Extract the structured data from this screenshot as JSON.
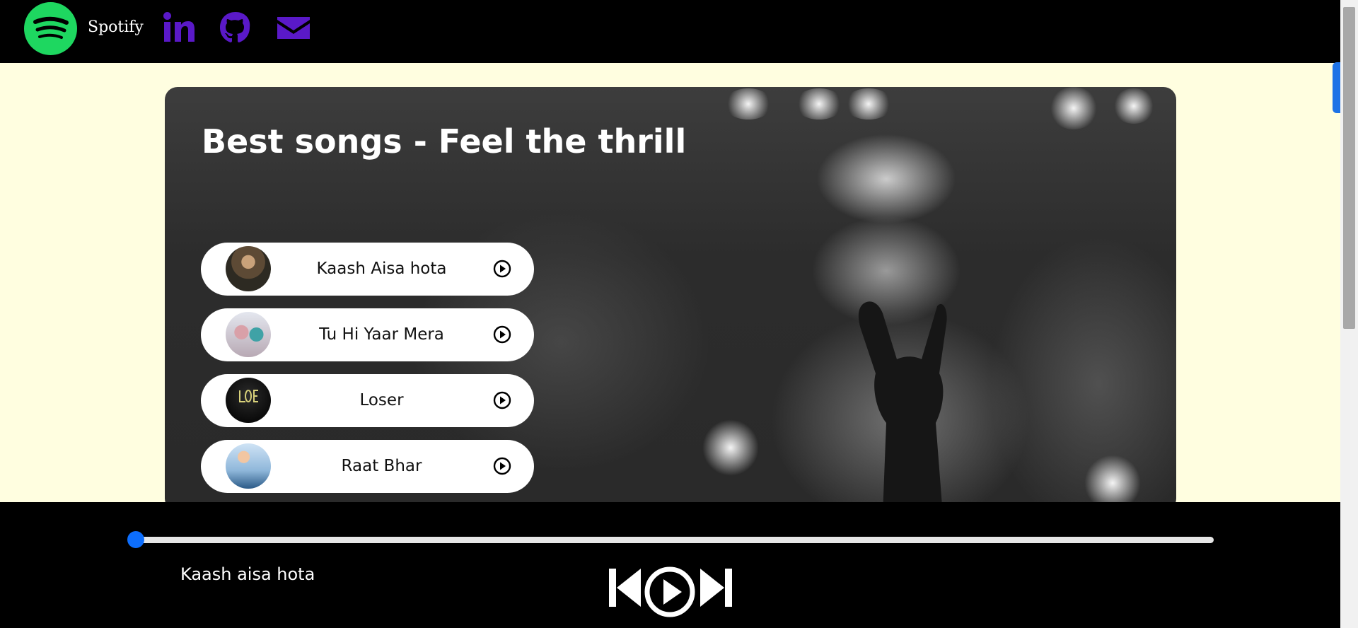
{
  "header": {
    "brand": "Spotify",
    "logo_icon": "spotify-logo-icon",
    "social": [
      {
        "name": "linkedin-icon"
      },
      {
        "name": "github-icon"
      },
      {
        "name": "email-icon"
      }
    ],
    "colors": {
      "header_bg": "#000000",
      "social": "#5a19c8",
      "logo": "#1ed760"
    }
  },
  "hero": {
    "title": "Best songs - Feel the thrill"
  },
  "songs": [
    {
      "title": "Kaash Aisa hota",
      "play_icon": "play-circle-icon"
    },
    {
      "title": "Tu Hi Yaar Mera",
      "play_icon": "play-circle-icon"
    },
    {
      "title": "Loser",
      "play_icon": "play-circle-icon"
    },
    {
      "title": "Raat Bhar",
      "play_icon": "play-circle-icon"
    }
  ],
  "player": {
    "now_playing": "Kaash aisa hota",
    "progress_percent": 0,
    "controls": [
      "previous-icon",
      "play-circle-icon",
      "next-icon"
    ],
    "accent": "#0d6efd"
  },
  "page_bg": "#fffee0"
}
